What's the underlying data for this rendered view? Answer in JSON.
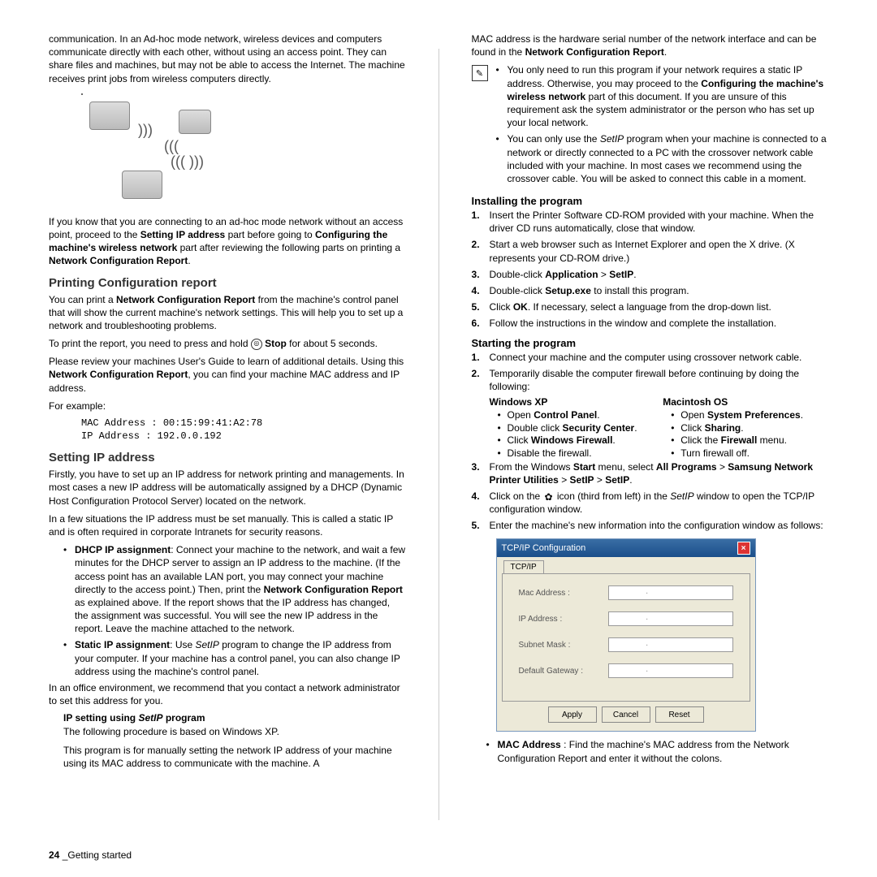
{
  "footer": {
    "page": "24",
    "section": "_Getting started"
  },
  "left": {
    "intro": "communication. In an Ad-hoc mode network, wireless devices and computers communicate directly with each other, without using an access point. They can share files and machines, but may not be able to access the Internet. The machine receives print jobs from wireless computers directly.",
    "afterimg": {
      "pre": "If you know that you are connecting to an ad-hoc mode network without an access point, proceed to the ",
      "b1": "Setting IP address",
      "mid1": " part before going to ",
      "b2": "Configuring the machine's wireless network",
      "mid2": " part after reviewing the following parts on printing a ",
      "b3": "Network Configuration Report",
      "post": "."
    },
    "h_print": "Printing Configuration report",
    "print_p1": {
      "pre": "You can print a ",
      "b": "Network Configuration Report",
      "post": " from the machine's control panel that will show the current machine's network settings. This will help you to set up a network and troubleshooting problems."
    },
    "print_p2": {
      "pre": "To print the report, you need to press and hold ",
      "b": "Stop",
      "post": " for about 5 seconds."
    },
    "print_p3": {
      "pre": "Please review your machines User's Guide to learn of additional details. Using this ",
      "b": "Network Configuration Report",
      "post": ", you can find your machine MAC address and IP address."
    },
    "eg_label": "For example:",
    "mac_line": "MAC Address    : 00:15:99:41:A2:78",
    "ip_line": "IP Address     : 192.0.0.192",
    "h_setip": "Setting IP address",
    "setip_p1": "Firstly, you have to set up an IP address for network printing and managements. In most cases a new IP address will be automatically assigned by a DHCP (Dynamic Host Configuration Protocol Server) located on the network.",
    "setip_p2": "In a few situations the IP address must be set manually.  This is called a static IP and is often required in corporate Intranets for security reasons.",
    "bul1": {
      "b": "DHCP IP assignment",
      "text": ": Connect your machine to the network, and wait a few minutes for the DHCP server to assign an IP address to the machine. (If the access point has an available LAN port, you may connect your machine directly to the access point.) Then, print the ",
      "b2": "Network Configuration Report",
      "text2": " as explained above. If the report shows that the IP address has changed, the assignment was successful. You will see the new IP address in the report. Leave the machine attached to the network."
    },
    "bul2": {
      "b": "Static IP assignment",
      "text": ": Use ",
      "i": "SetIP",
      "text2": " program to change the IP address from your computer. If your machine has a control panel, you can also change IP address using the machine's control panel."
    },
    "office": "In an office environment, we recommend that you contact a network administrator to set this address for you.",
    "h_ipsetup": "IP setting using ",
    "h_ipsetup_i": "SetIP",
    "h_ipsetup2": " program",
    "ip_p1": "The following procedure is based on Windows XP.",
    "ip_p2": "This program is for manually setting the network IP address of your machine using its MAC address to communicate with the machine. A"
  },
  "right": {
    "top": {
      "pre": "MAC address is the hardware serial number of the network interface and can be found in the ",
      "b": "Network Configuration Report",
      "post": "."
    },
    "note1": {
      "pre": "You only need to run this program if your network requires a static IP address. Otherwise, you may proceed to the ",
      "b": "Configuring the machine's wireless network",
      "post": " part of this document. If you are unsure of this requirement ask the system administrator or the person who has set up your local network."
    },
    "note2": {
      "pre": "You can only use the ",
      "i": "SetIP",
      "post": " program when your machine is connected to a network or directly connected to a PC with the crossover network cable included with your machine.  In most cases we recommend using the crossover cable. You will be asked to connect this cable in a moment."
    },
    "h_install": "Installing the program",
    "inst": {
      "s1": "Insert the Printer Software CD-ROM provided with your machine. When the driver CD runs automatically, close that window.",
      "s2": "Start a web browser such as Internet Explorer and open the X drive. (X represents your CD-ROM drive.)",
      "s3": {
        "pre": "Double-click ",
        "b1": "Application",
        "mid": " > ",
        "b2": "SetIP",
        "post": "."
      },
      "s4": {
        "pre": "Double-click ",
        "b": "Setup.exe",
        "post": " to install this program."
      },
      "s5": {
        "pre": "Click ",
        "b": "OK",
        "post": ". If necessary, select a language from the drop-down list."
      },
      "s6": "Follow the instructions in the window and complete the installation."
    },
    "h_start": "Starting the program",
    "start": {
      "s1": "Connect your machine and the computer using crossover network cable.",
      "s2": "Temporarily disable the computer firewall before continuing by doing the following:",
      "winhdr": "Windows XP",
      "win": {
        "a": "Open ",
        "a_b": "Control Panel",
        "a2": ".",
        "b": "Double click ",
        "b_b": "Security Center",
        "b2": ".",
        "c": "Click ",
        "c_b": "Windows Firewall",
        "c2": ".",
        "d": "Disable the firewall."
      },
      "machdr": "Macintosh OS",
      "mac": {
        "a": "Open ",
        "a_b": "System Preferences",
        "a2": ".",
        "b": "Click ",
        "b_b": "Sharing",
        "b2": ".",
        "c": "Click the ",
        "c_b": "Firewall",
        "c2": " menu.",
        "d": "Turn firewall off."
      },
      "s3": {
        "pre": "From the Windows ",
        "b1": "Start",
        "m1": " menu, select ",
        "b2": "All Programs",
        "m2": " > ",
        "b3": "Samsung Network Printer Utilities",
        "m3": " > ",
        "b4": "SetIP",
        "m4": " > ",
        "b5": "SetIP",
        "post": "."
      },
      "s4": {
        "pre": "Click on the ",
        "mid": " icon (third from left) in the ",
        "i": "SetIP",
        "post": " window to open the TCP/IP configuration window."
      },
      "s5": "Enter the machine's new information into the configuration window as follows:"
    },
    "tcpip": {
      "title": "TCP/IP Configuration",
      "tab": "TCP/IP",
      "mac": "Mac Address :",
      "ip": "IP Address :",
      "sub": "Subnet Mask :",
      "gw": "Default Gateway :",
      "apply": "Apply",
      "cancel": "Cancel",
      "reset": "Reset"
    },
    "last": {
      "b": "MAC Address",
      "text": " : Find the machine's MAC address from the Network Configuration Report and enter it without the colons."
    }
  }
}
